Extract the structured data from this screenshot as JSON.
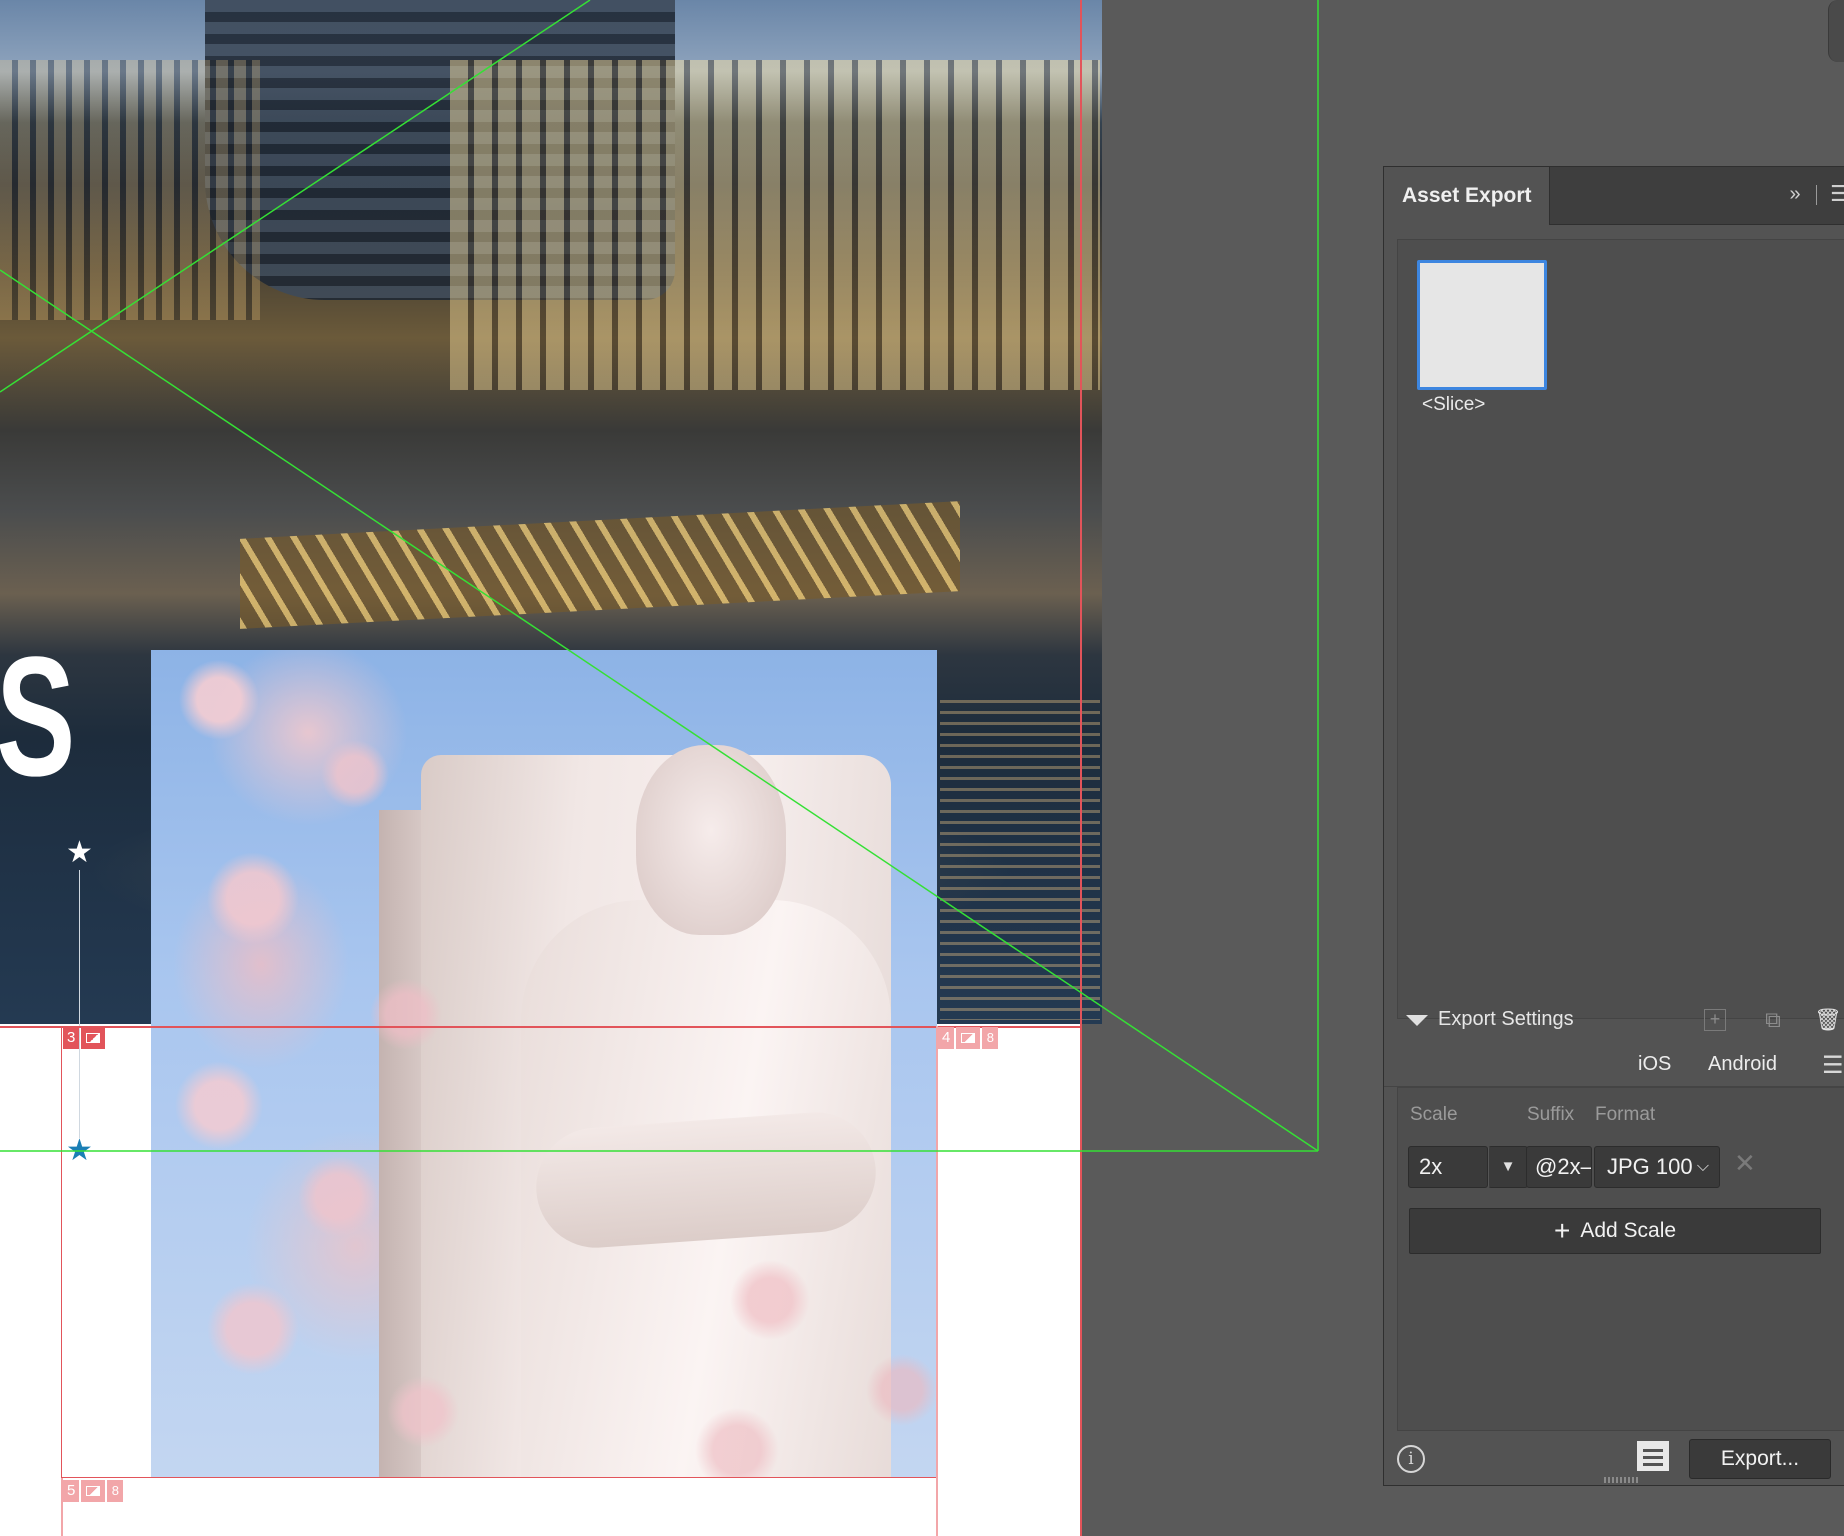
{
  "canvas": {
    "big_letter": "S",
    "frames": [
      {
        "number": "3"
      },
      {
        "number": "4",
        "link_mark": "8"
      },
      {
        "number": "5",
        "link_mark": "8"
      }
    ]
  },
  "asset_export": {
    "title": "Asset Export",
    "collapse_glyph": "»",
    "assets": [
      {
        "label": "<Slice>"
      }
    ],
    "export_settings": {
      "title": "Export Settings",
      "platforms": [
        "iOS",
        "Android"
      ],
      "columns": {
        "scale": "Scale",
        "suffix": "Suffix",
        "format": "Format"
      },
      "rows": [
        {
          "scale": "2x",
          "suffix": "@2x–",
          "format": "JPG 100"
        }
      ],
      "add_scale_label": "Add Scale"
    },
    "export_button_label": "Export..."
  },
  "colors": {
    "frame_red": "#e2545a",
    "guide_green": "#35e035",
    "selection_blue": "#3d86e0",
    "panel_bg": "#535353"
  }
}
